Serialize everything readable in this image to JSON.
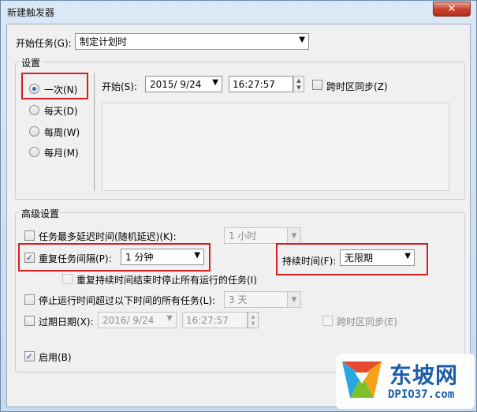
{
  "window": {
    "title": "新建触发器",
    "close_glyph": "✕"
  },
  "begin_task": {
    "label": "开始任务(G):",
    "value": "制定计划时"
  },
  "settings": {
    "title": "设置",
    "radios": [
      {
        "label": "一次(N)",
        "checked": true
      },
      {
        "label": "每天(D)",
        "checked": false
      },
      {
        "label": "每周(W)",
        "checked": false
      },
      {
        "label": "每月(M)",
        "checked": false
      }
    ],
    "start_label": "开始(S):",
    "start_date": "2015/ 9/24",
    "start_time": "16:27:57",
    "sync_timezone": "跨时区同步(Z)"
  },
  "advanced": {
    "title": "高级设置",
    "delay_label": "任务最多延迟时间(随机延迟)(K):",
    "delay_value": "1 小时",
    "repeat_label": "重复任务间隔(P):",
    "repeat_value": "1 分钟",
    "duration_label": "持续时间(F):",
    "duration_value": "无限期",
    "stop_running_label": "重复持续时间结束时停止所有运行的任务(I)",
    "stop_longer_label": "停止运行时间超过以下时间的所有任务(L):",
    "stop_longer_value": "3 天",
    "expire_label": "过期日期(X):",
    "expire_date": "2016/ 9/24",
    "expire_time": "16:27:57",
    "expire_sync": "跨时区同步(E)",
    "enabled_label": "启用(B)"
  },
  "watermark": {
    "brand": "东坡网",
    "url": "DPIO37.com"
  },
  "icons": {
    "arrow": "▼",
    "check": "✓",
    "up": "▲",
    "down": "▼"
  },
  "colors": {
    "highlight": "#d42020",
    "accent": "#2a6ebb"
  }
}
